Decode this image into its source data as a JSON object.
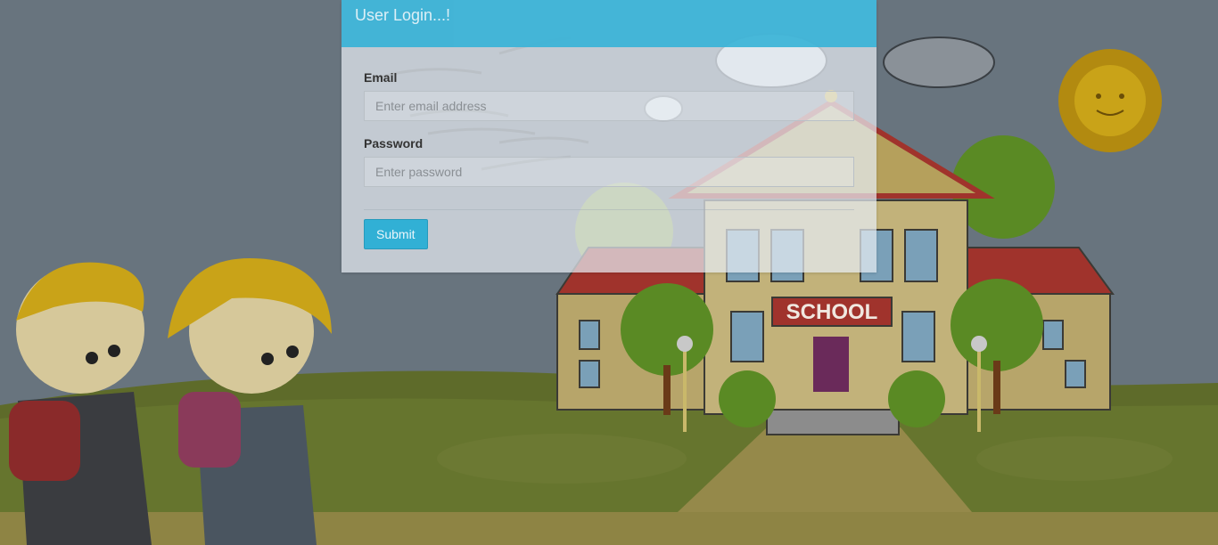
{
  "login": {
    "title": "User Login...!",
    "email_label": "Email",
    "email_placeholder": "Enter email address",
    "password_label": "Password",
    "password_placeholder": "Enter password",
    "submit_label": "Submit"
  },
  "background": {
    "school_sign": "SCHOOL",
    "colors": {
      "sky": "#68747e",
      "grass": "#5e6b2a",
      "path": "#9a8a4a",
      "panel_header": "#39b3d7",
      "button": "#31b0d5"
    }
  }
}
